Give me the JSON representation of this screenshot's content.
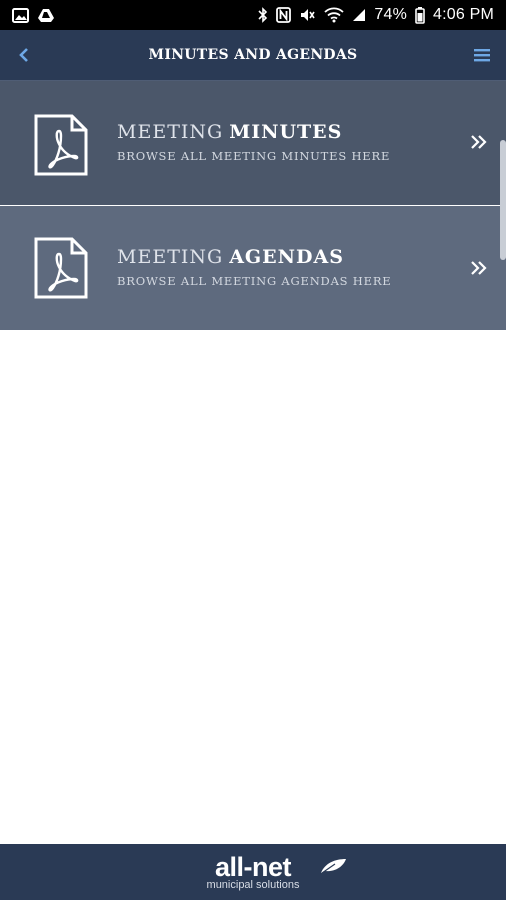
{
  "status_bar": {
    "battery": "74%",
    "time": "4:06 PM"
  },
  "header": {
    "title": "MINUTES AND AGENDAS"
  },
  "rows": [
    {
      "title_light": "MEETING",
      "title_bold": "MINUTES",
      "subtitle": "BROWSE ALL MEETING MINUTES HERE"
    },
    {
      "title_light": "MEETING",
      "title_bold": "AGENDAS",
      "subtitle": "BROWSE ALL MEETING AGENDAS HERE"
    }
  ],
  "footer": {
    "brand": "all-net",
    "tagline": "municipal solutions"
  },
  "colors": {
    "header_bg": "#2a3a55",
    "row_minutes_bg": "#4b576a",
    "row_agendas_bg": "#5e6a7e",
    "accent_icon": "#6ea8e6"
  }
}
